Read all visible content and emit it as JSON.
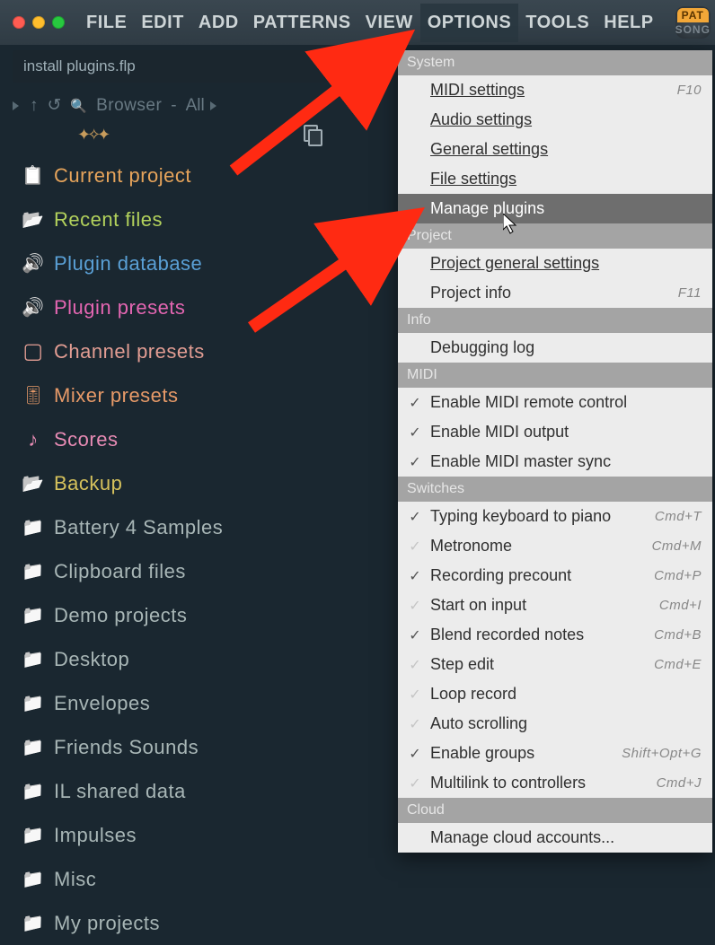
{
  "menubar": {
    "items": [
      "FILE",
      "EDIT",
      "ADD",
      "PATTERNS",
      "VIEW",
      "OPTIONS",
      "TOOLS",
      "HELP"
    ],
    "active_index": 5,
    "pat_label": "PAT",
    "song_label": "SONG"
  },
  "filename": "install plugins.flp",
  "browser_header": {
    "label": "Browser",
    "filter": "All"
  },
  "browser": [
    {
      "icon": "clip",
      "label": "Current project",
      "color": "c-orange"
    },
    {
      "icon": "foldero",
      "label": "Recent files",
      "color": "c-lime"
    },
    {
      "icon": "speaker",
      "label": "Plugin database",
      "color": "c-blue"
    },
    {
      "icon": "speaker",
      "label": "Plugin presets",
      "color": "c-magenta"
    },
    {
      "icon": "square",
      "label": "Channel presets",
      "color": "c-salmon"
    },
    {
      "icon": "sliders",
      "label": "Mixer presets",
      "color": "c-orange2"
    },
    {
      "icon": "note",
      "label": "Scores",
      "color": "c-pink"
    },
    {
      "icon": "foldero",
      "label": "Backup",
      "color": "c-yellow"
    },
    {
      "icon": "folder",
      "label": "Battery 4 Samples",
      "color": "c-grey"
    },
    {
      "icon": "folder",
      "label": "Clipboard files",
      "color": "c-grey"
    },
    {
      "icon": "folder",
      "label": "Demo projects",
      "color": "c-grey"
    },
    {
      "icon": "folder",
      "label": "Desktop",
      "color": "c-grey"
    },
    {
      "icon": "folder",
      "label": "Envelopes",
      "color": "c-grey"
    },
    {
      "icon": "folder",
      "label": "Friends Sounds",
      "color": "c-grey"
    },
    {
      "icon": "folder",
      "label": "IL shared data",
      "color": "c-grey"
    },
    {
      "icon": "folder",
      "label": "Impulses",
      "color": "c-grey"
    },
    {
      "icon": "folder",
      "label": "Misc",
      "color": "c-grey"
    },
    {
      "icon": "folder",
      "label": "My projects",
      "color": "c-grey"
    }
  ],
  "options_menu": {
    "sections": [
      {
        "header": "System",
        "items": [
          {
            "label": "MIDI settings",
            "shortcut": "F10",
            "underline": true
          },
          {
            "label": "Audio settings",
            "underline": true
          },
          {
            "label": "General settings",
            "underline": true
          },
          {
            "label": "File settings",
            "underline": true
          },
          {
            "label": "Manage plugins",
            "highlight": true
          }
        ]
      },
      {
        "header": "Project",
        "items": [
          {
            "label": "Project general settings",
            "underline": true
          },
          {
            "label": "Project info",
            "shortcut": "F11"
          }
        ]
      },
      {
        "header": "Info",
        "items": [
          {
            "label": "Debugging log"
          }
        ]
      },
      {
        "header": "MIDI",
        "items": [
          {
            "label": "Enable MIDI remote control",
            "checked": true
          },
          {
            "label": "Enable MIDI output",
            "checked": true
          },
          {
            "label": "Enable MIDI master sync",
            "checked": true
          }
        ]
      },
      {
        "header": "Switches",
        "items": [
          {
            "label": "Typing keyboard to piano",
            "checked": true,
            "shortcut": "Cmd+T"
          },
          {
            "label": "Metronome",
            "checked": false,
            "shortcut": "Cmd+M"
          },
          {
            "label": "Recording precount",
            "checked": true,
            "shortcut": "Cmd+P"
          },
          {
            "label": "Start on input",
            "checked": false,
            "shortcut": "Cmd+I"
          },
          {
            "label": "Blend recorded notes",
            "checked": true,
            "shortcut": "Cmd+B"
          },
          {
            "label": "Step edit",
            "checked": false,
            "shortcut": "Cmd+E"
          },
          {
            "label": "Loop record",
            "checked": false
          },
          {
            "label": "Auto scrolling",
            "checked": false
          },
          {
            "label": "Enable groups",
            "checked": true,
            "shortcut": "Shift+Opt+G"
          },
          {
            "label": "Multilink to controllers",
            "checked": false,
            "shortcut": "Cmd+J"
          }
        ]
      },
      {
        "header": "Cloud",
        "items": [
          {
            "label": "Manage cloud accounts..."
          }
        ]
      }
    ]
  }
}
